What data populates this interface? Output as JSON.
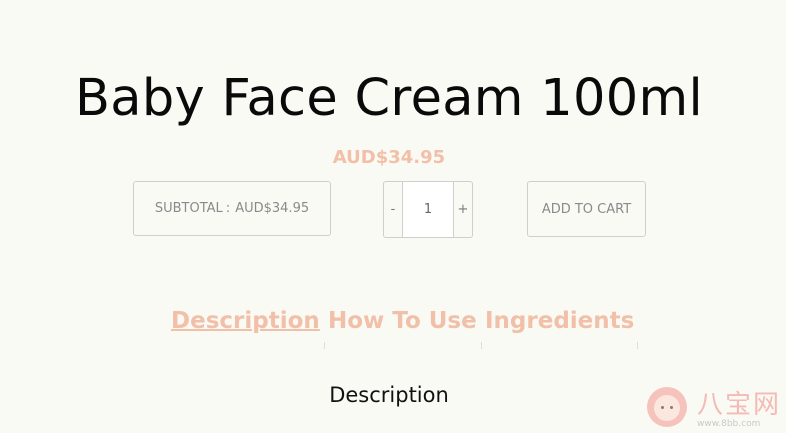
{
  "product": {
    "title": "Baby Face Cream 100ml",
    "price": "AUD$34.95"
  },
  "subtotal": {
    "label": "SUBTOTAL",
    "separator": ":",
    "value": "AUD$34.95"
  },
  "quantity": {
    "decrement": "-",
    "value": "1",
    "increment": "+"
  },
  "add_to_cart": "ADD TO CART",
  "tabs": [
    {
      "label": "Description",
      "active": true
    },
    {
      "label": "How To Use",
      "active": false
    },
    {
      "label": "Ingredients",
      "active": false
    }
  ],
  "section": {
    "heading": "Description"
  },
  "watermark": {
    "brand": "八宝网",
    "url": "www.8bb.com"
  },
  "colors": {
    "background": "#fafaf5",
    "accent": "#f2bfa8",
    "border": "#cfcfcf",
    "muted_text": "#8a8a8a"
  }
}
